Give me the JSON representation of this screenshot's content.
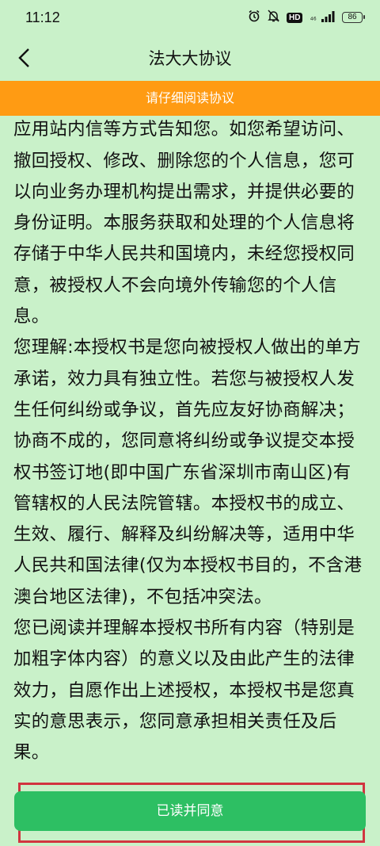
{
  "status_bar": {
    "time": "11:12",
    "signal_text": "⁴⁶",
    "battery": "86"
  },
  "header": {
    "title": "法大大协议"
  },
  "banner": {
    "text": "请仔细阅读协议"
  },
  "agreement": {
    "paragraphs": [
      "您，我们将及时以公告、通过业务办理机构应用站内信等方式告知您。如您希望访问、撤回授权、修改、删除您的个人信息，您可以向业务办理机构提出需求，并提供必要的身份证明。本服务获取和处理的个人信息将存储于中华人民共和国境内，未经您授权同意，被授权人不会向境外传输您的个人信息。",
      "您理解:本授权书是您向被授权人做出的单方承诺，效力具有独立性。若您与被授权人发生任何纠纷或争议，首先应友好协商解决；协商不成的，您同意将纠纷或争议提交本授权书签订地(即中国广东省深圳市南山区)有管辖权的人民法院管辖。本授权书的成立、生效、履行、解释及纠纷解决等，适用中华人民共和国法律(仅为本授权书目的，不含港澳台地区法律)，不包括冲突法。",
      "您已阅读并理解本授权书所有内容（特别是加粗字体内容）的意义以及由此产生的法律效力，自愿作出上述授权，本授权书是您真实的意思表示，您同意承担相关责任及后果。"
    ]
  },
  "footer": {
    "agree_label": "已读并同意"
  },
  "colors": {
    "background": "#c9f1c9",
    "banner": "#ff9b13",
    "button": "#2dbf63",
    "highlight_box": "#d1343f"
  }
}
